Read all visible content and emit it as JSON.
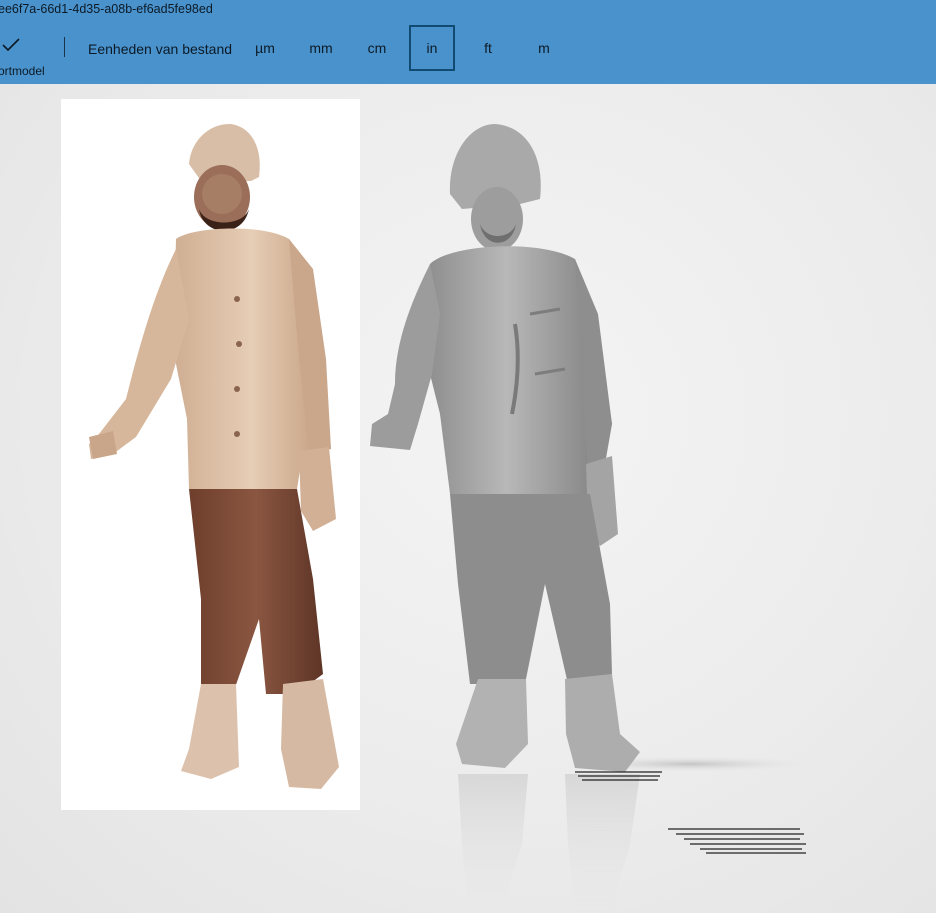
{
  "window": {
    "title": "ee6f7a-66d1-4d35-a08b-ef6ad5fe98ed"
  },
  "toolbar": {
    "import_label": "ortmodel",
    "units_label": "Eenheden van bestand",
    "units": [
      "µm",
      "mm",
      "cm",
      "in",
      "ft",
      "m"
    ],
    "selected_unit": "in",
    "accent_color": "#4a92cc",
    "selected_border_color": "#124a73"
  },
  "icons": {
    "import": "checkmark-icon"
  },
  "viewport": {
    "background_color": "#ebebeb",
    "photo_background_color": "#ffffff",
    "model_color": "#9a9a9a"
  }
}
